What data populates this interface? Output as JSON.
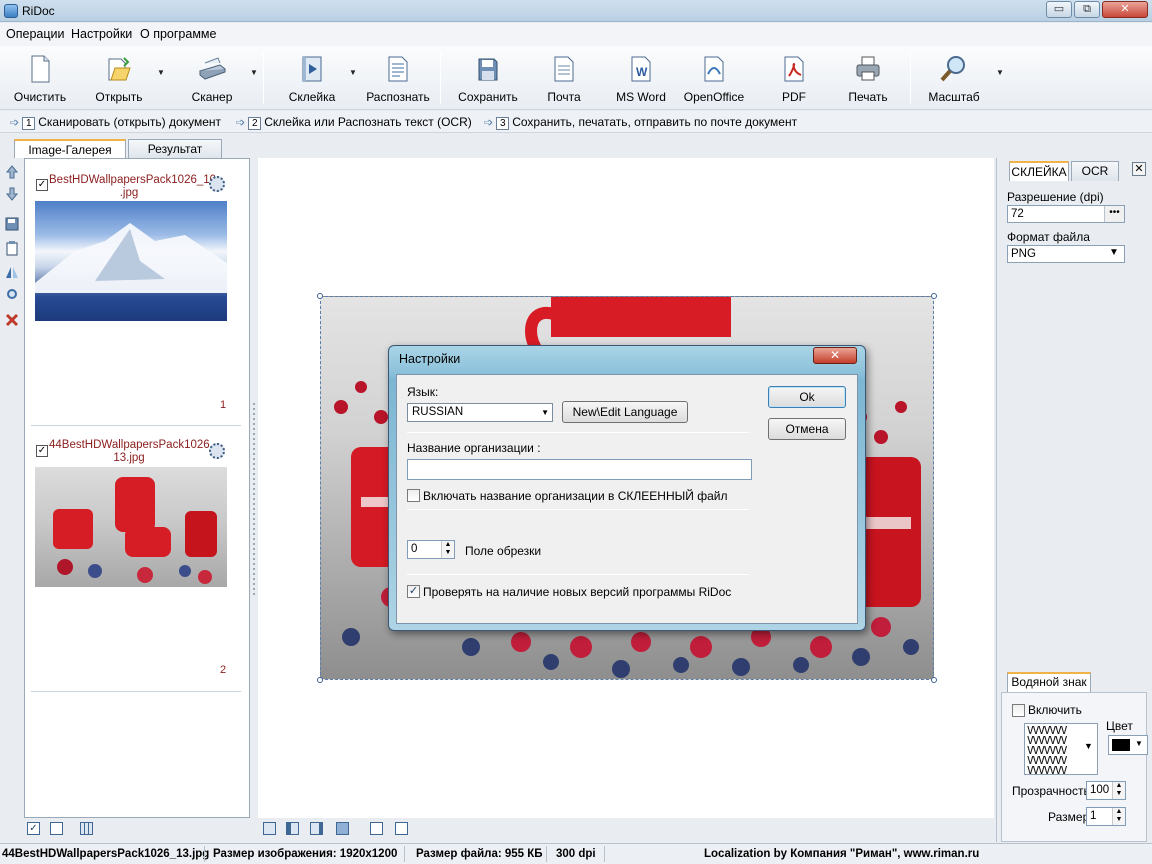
{
  "window": {
    "title": "RiDoc",
    "min_label": "▭",
    "restore_label": "⧉",
    "close_label": "✕"
  },
  "menu": [
    "Операции",
    "Настройки",
    "О программе"
  ],
  "toolbar": [
    {
      "label": "Очистить",
      "icon": "document-icon"
    },
    {
      "label": "Открыть",
      "icon": "open-folder-icon"
    },
    {
      "label": "Сканер",
      "icon": "scanner-icon"
    },
    {
      "label": "Склейка",
      "icon": "film-icon"
    },
    {
      "label": "Распознать",
      "icon": "ocr-icon"
    },
    {
      "label": "Сохранить",
      "icon": "save-icon"
    },
    {
      "label": "Почта",
      "icon": "mail-icon"
    },
    {
      "label": "MS Word",
      "icon": "word-icon"
    },
    {
      "label": "OpenOffice",
      "icon": "openoffice-icon"
    },
    {
      "label": "PDF",
      "icon": "pdf-icon"
    },
    {
      "label": "Печать",
      "icon": "printer-icon"
    },
    {
      "label": "Масштаб",
      "icon": "zoom-icon"
    }
  ],
  "steps": [
    {
      "num": "1",
      "text": "Сканировать (открыть) документ"
    },
    {
      "num": "2",
      "text": "Склейка или Распознать текст (OCR)"
    },
    {
      "num": "3",
      "text": "Сохранить, печатать, отправить по почте документ"
    }
  ],
  "tabs": {
    "gallery": "Image-Галерея",
    "result": "Результат"
  },
  "gallery": [
    {
      "name": "BestHDWallpapersPack1026_10 .jpg",
      "number": "1",
      "checked": true
    },
    {
      "name": "44BestHDWallpapersPack1026_ 13.jpg",
      "number": "2",
      "checked": true
    }
  ],
  "right_panel": {
    "tab_glue": "СКЛЕЙКА",
    "tab_ocr": "OCR",
    "close": "✕",
    "resolution_label": "Разрешение (dpi)",
    "resolution_value": "72",
    "dots": "•••",
    "format_label": "Формат файла",
    "format_value": "PNG",
    "watermark_tab": "Водяной знак",
    "enable_label": "Включить",
    "color_label": "Цвет",
    "transparency_label": "Прозрачность",
    "transparency_value": "100",
    "size_label": "Размер",
    "size_value": "1",
    "pattern": "VVVVVVV VVVVVVV VVVVVVV VVVVVVV VVVVVVV"
  },
  "dialog": {
    "title": "Настройки",
    "close": "✕",
    "language_label": "Язык:",
    "language_value": "RUSSIAN",
    "edit_language": "New\\Edit Language",
    "ok": "Ok",
    "cancel": "Отмена",
    "org_label": "Название организации :",
    "org_value": "",
    "include_org_label": "Включать название организации в СКЛЕЕННЫЙ файл",
    "include_org_checked": false,
    "crop_value": "0",
    "crop_label": "Поле обрезки",
    "check_updates_label": "Проверять на наличие новых версий программы RiDoc",
    "check_updates_checked": true
  },
  "status": {
    "file": "44BestHDWallpapersPack1026_13.jpg",
    "image_size": "Размер изображения: 1920x1200",
    "file_size": "Размер файла: 955 КБ",
    "dpi": "300 dpi",
    "localization": "Localization by Компания \"Риман\", www.riman.ru"
  },
  "colors": {
    "accent_tab": "#f2b24a",
    "thumb_text": "#8b1d1d"
  }
}
